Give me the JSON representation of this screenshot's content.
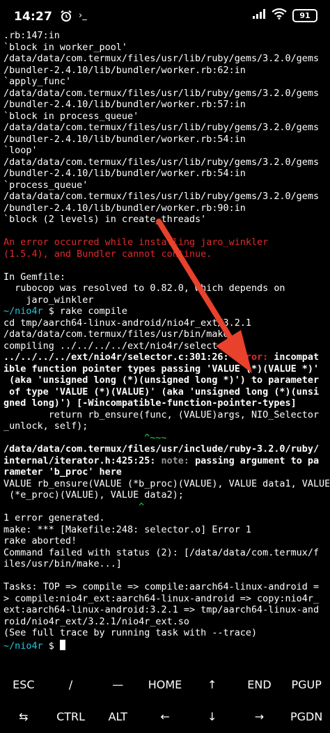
{
  "status_bar": {
    "time": "14:27",
    "alarm_icon": "alarm-clock-icon",
    "notification_icon": "terminal-prompt-icon",
    "battery": "91"
  },
  "terminal": {
    "lines": [
      {
        "text": ".rb:147:in",
        "color": "white"
      },
      {
        "text": "`block in worker_pool'",
        "color": "white"
      },
      {
        "text": "/data/data/com.termux/files/usr/lib/ruby/gems/3.2.0/gems",
        "color": "white"
      },
      {
        "text": "/bundler-2.4.10/lib/bundler/worker.rb:62:in",
        "color": "white"
      },
      {
        "text": "`apply_func'",
        "color": "white"
      },
      {
        "text": "/data/data/com.termux/files/usr/lib/ruby/gems/3.2.0/gems",
        "color": "white"
      },
      {
        "text": "/bundler-2.4.10/lib/bundler/worker.rb:57:in",
        "color": "white"
      },
      {
        "text": "`block in process_queue'",
        "color": "white"
      },
      {
        "text": "/data/data/com.termux/files/usr/lib/ruby/gems/3.2.0/gems",
        "color": "white"
      },
      {
        "text": "/bundler-2.4.10/lib/bundler/worker.rb:54:in",
        "color": "white"
      },
      {
        "text": "`loop'",
        "color": "white"
      },
      {
        "text": "/data/data/com.termux/files/usr/lib/ruby/gems/3.2.0/gems",
        "color": "white"
      },
      {
        "text": "/bundler-2.4.10/lib/bundler/worker.rb:54:in",
        "color": "white"
      },
      {
        "text": "`process_queue'",
        "color": "white"
      },
      {
        "text": "/data/data/com.termux/files/usr/lib/ruby/gems/3.2.0/gems",
        "color": "white"
      },
      {
        "text": "/bundler-2.4.10/lib/bundler/worker.rb:90:in",
        "color": "white"
      },
      {
        "text": "`block (2 levels) in create_threads'",
        "color": "white"
      },
      {
        "text": "",
        "color": "white"
      },
      {
        "text": "An error occurred while installing jaro_winkler",
        "color": "red"
      },
      {
        "text": "(1.5.4), and Bundler cannot continue.",
        "color": "red"
      },
      {
        "text": "",
        "color": "white"
      },
      {
        "text": "In Gemfile:",
        "color": "white"
      },
      {
        "text": "  rubocop was resolved to 0.82.0, which depends on",
        "color": "white"
      },
      {
        "text": "    jaro_winkler",
        "color": "white"
      },
      {
        "segments": [
          {
            "text": "~/nio4r",
            "color": "cyan"
          },
          {
            "text": " $ rake compile",
            "color": "white"
          }
        ]
      },
      {
        "text": "cd tmp/aarch64-linux-android/nio4r_ext/3.2.1",
        "color": "white"
      },
      {
        "text": "/data/data/com.termux/files/usr/bin/make",
        "color": "white"
      },
      {
        "text": "compiling ../../../../ext/nio4r/selector.c",
        "color": "white"
      },
      {
        "segments": [
          {
            "text": "../../../../ext/nio4r/selector.c:301:26: ",
            "color": "white",
            "bold": true
          },
          {
            "text": "error: ",
            "color": "red",
            "bold": true
          },
          {
            "text": "incompat",
            "color": "white",
            "bold": true
          }
        ]
      },
      {
        "text": "ible function pointer types passing 'VALUE (*)(VALUE *)'",
        "color": "white",
        "bold": true
      },
      {
        "text": " (aka 'unsigned long (*)(unsigned long *)') to parameter",
        "color": "white",
        "bold": true
      },
      {
        "text": " of type 'VALUE (*)(VALUE)' (aka 'unsigned long (*)(unsi",
        "color": "white",
        "bold": true
      },
      {
        "text": "gned long)') [-Wincompatible-function-pointer-types]",
        "color": "white",
        "bold": true
      },
      {
        "text": "        return rb_ensure(func, (VALUE)args, NIO_Selector",
        "color": "white"
      },
      {
        "text": "_unlock, self);",
        "color": "white"
      },
      {
        "text": "                         ^~~~",
        "color": "green"
      },
      {
        "text": "/data/data/com.termux/files/usr/include/ruby-3.2.0/ruby/",
        "color": "white",
        "bold": true
      },
      {
        "segments": [
          {
            "text": "internal/iterator.h:425:25: ",
            "color": "white",
            "bold": true
          },
          {
            "text": "note: ",
            "color": "gray",
            "bold": true
          },
          {
            "text": "passing argument to pa",
            "color": "white",
            "bold": true
          }
        ]
      },
      {
        "text": "rameter 'b_proc' here",
        "color": "white",
        "bold": true
      },
      {
        "text": "VALUE rb_ensure(VALUE (*b_proc)(VALUE), VALUE data1, VALUE",
        "color": "white"
      },
      {
        "text": " (*e_proc)(VALUE), VALUE data2);",
        "color": "white"
      },
      {
        "text": "                        ^",
        "color": "green"
      },
      {
        "text": "1 error generated.",
        "color": "white"
      },
      {
        "text": "make: *** [Makefile:248: selector.o] Error 1",
        "color": "white"
      },
      {
        "text": "rake aborted!",
        "color": "white"
      },
      {
        "text": "Command failed with status (2): [/data/data/com.termux/f",
        "color": "white"
      },
      {
        "text": "iles/usr/bin/make...]",
        "color": "white"
      },
      {
        "text": "",
        "color": "white"
      },
      {
        "text": "Tasks: TOP => compile => compile:aarch64-linux-android =",
        "color": "white"
      },
      {
        "text": "> compile:nio4r_ext:aarch64-linux-android => copy:nio4r_",
        "color": "white"
      },
      {
        "text": "ext:aarch64-linux-android:3.2.1 => tmp/aarch64-linux-and",
        "color": "white"
      },
      {
        "text": "roid/nio4r_ext/3.2.1/nio4r_ext.so",
        "color": "white"
      },
      {
        "text": "(See full trace by running task with --trace)",
        "color": "white"
      },
      {
        "segments": [
          {
            "text": "~/nio4r",
            "color": "cyan"
          },
          {
            "text": " $ ",
            "color": "white"
          }
        ],
        "cursor": true
      }
    ]
  },
  "extra_keys": {
    "row1": [
      "ESC",
      "/",
      "—",
      "HOME",
      "↑",
      "END",
      "PGUP"
    ],
    "row2": [
      "⇆",
      "CTRL",
      "ALT",
      "←",
      "↓",
      "→",
      "PGDN"
    ]
  },
  "annotation": {
    "arrow_color": "#e8412c"
  }
}
